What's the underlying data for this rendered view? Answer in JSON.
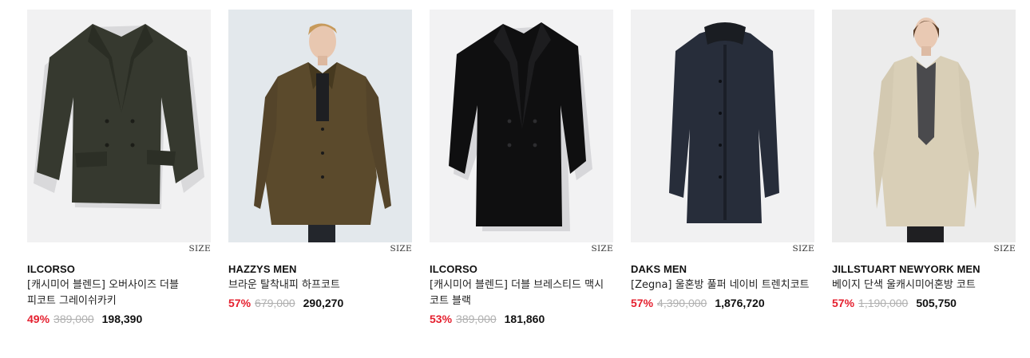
{
  "products": [
    {
      "brand": "ILCORSO",
      "title": "[캐시미어 블렌드] 오버사이즈 더블 피코트 그레이쉬카키",
      "discount": "49%",
      "original_price": "389,000",
      "price": "198,390",
      "size_label": "SIZE",
      "image": "dark-khaki-double-peacoat"
    },
    {
      "brand": "HAZZYS MEN",
      "title": "브라운 탈착내피 하프코트",
      "discount": "57%",
      "original_price": "679,000",
      "price": "290,270",
      "size_label": "SIZE",
      "image": "model-brown-half-coat"
    },
    {
      "brand": "ILCORSO",
      "title": "[캐시미어 블렌드] 더블 브레스티드 맥시 코트 블랙",
      "discount": "53%",
      "original_price": "389,000",
      "price": "181,860",
      "size_label": "SIZE",
      "image": "black-double-breasted-maxi-coat"
    },
    {
      "brand": "DAKS MEN",
      "title": "[Zegna] 울혼방 풀퍼 네이비 트렌치코트",
      "discount": "57%",
      "original_price": "4,390,000",
      "price": "1,876,720",
      "size_label": "SIZE",
      "image": "navy-fur-trench-coat"
    },
    {
      "brand": "JILLSTUART NEWYORK MEN",
      "title": "베이지 단색 울캐시미어혼방 코트",
      "discount": "57%",
      "original_price": "1,190,000",
      "price": "505,750",
      "size_label": "SIZE",
      "image": "model-beige-long-coat"
    }
  ],
  "colors": {
    "discount": "#e5202f",
    "strike": "#b0b0b0",
    "text": "#111111"
  }
}
